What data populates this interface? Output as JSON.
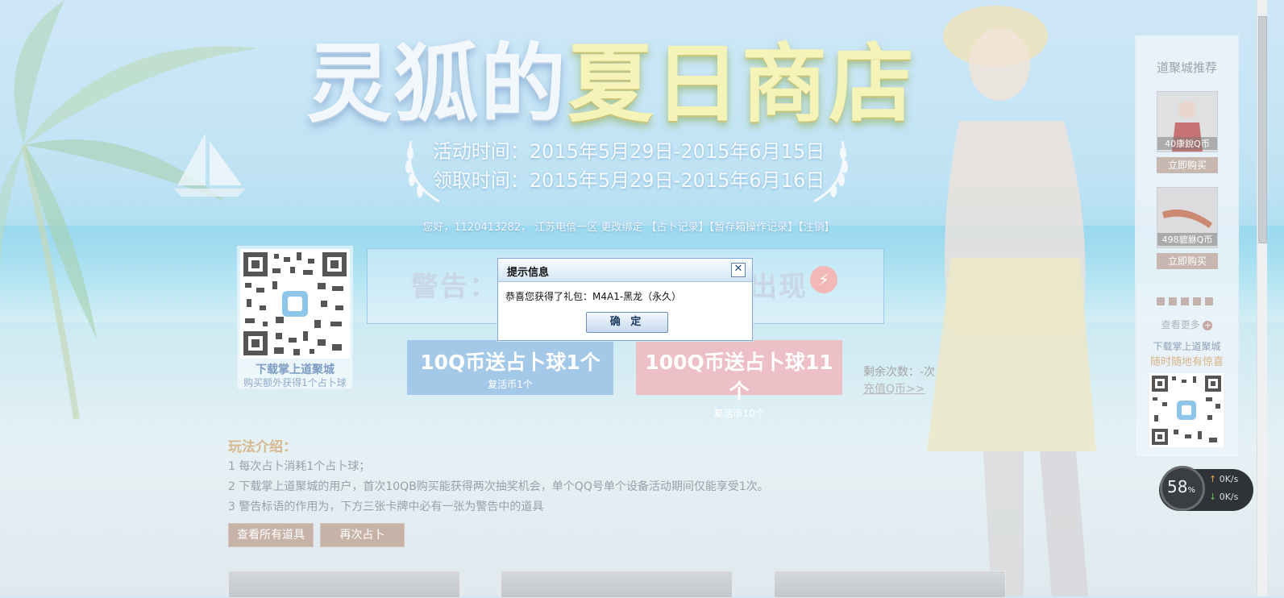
{
  "banner": {
    "title_white": "灵狐的",
    "title_yellow": "夏日商店",
    "activity_time": "活动时间：2015年5月29日-2015年6月15日",
    "claim_time": "领取时间：2015年5月29日-2015年6月16日"
  },
  "userbar": {
    "greeting": "您好，1120413282，",
    "region": "江苏电信一区",
    "change_bind": "更改绑定",
    "fortune_record": "【占卜记录】",
    "storage_record": "【暂存箱操作记录】",
    "logout": "【注销】"
  },
  "qr_left": {
    "caption": "下载掌上道聚城",
    "subcaption": "购买额外获得1个占卜球"
  },
  "warning": {
    "prefix": "警告：",
    "suffix": "出现"
  },
  "buy_options": [
    {
      "title": "10Q币送占卜球1个",
      "subtitle": "复活币1个",
      "color": "#a4c8e7"
    },
    {
      "title": "100Q币送占卜球11个",
      "subtitle": "复活币10个",
      "color": "#edbfc7"
    }
  ],
  "remaining": "剩余次数：-次",
  "recharge_link": "充值Q币>>",
  "rules": {
    "title": "玩法介绍：",
    "items": [
      "1  每次占卜消耗1个占卜球；",
      "2  下载掌上道聚城的用户，首次10QB购买能获得两次抽奖机会，单个QQ号单个设备活动期间仅能享受1次。",
      "3  警告标语的作用为，下方三张卡牌中必有一张为警告中的道具"
    ]
  },
  "actions": {
    "view_all": "查看所有道具",
    "again": "再次占卜"
  },
  "panel": {
    "title": "道聚城推荐",
    "products": [
      {
        "price": "40康銳Q币",
        "buy": "立即购买"
      },
      {
        "price": "498貔貅Q币",
        "buy": "立即购买"
      }
    ],
    "more": "查看更多",
    "caption1": "下载掌上道聚城",
    "caption2": "随时随地有惊喜"
  },
  "net_widget": {
    "percent": "58",
    "percent_sign": "%",
    "up": "0K/s",
    "down": "0K/s"
  },
  "dialog": {
    "title": "提示信息",
    "close_symbol": "✕",
    "message": "恭喜您获得了礼包：M4A1-黑龙（永久）",
    "ok": "确 定"
  }
}
